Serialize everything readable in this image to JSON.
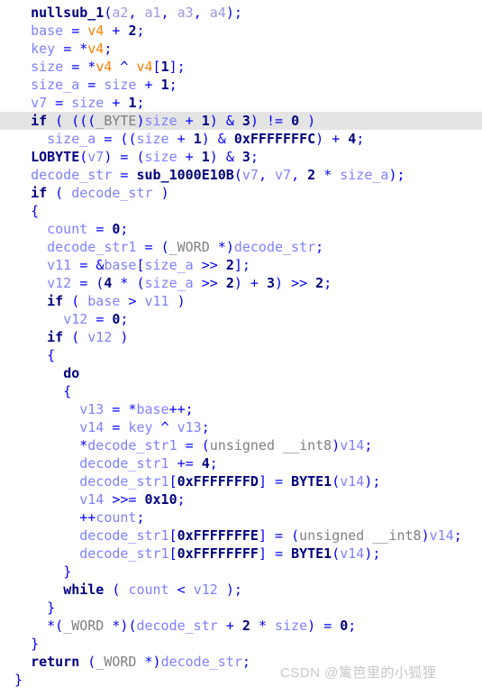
{
  "editor": {
    "kind": "decompiler-pseudocode",
    "language": "C",
    "highlighted_line_index": 6,
    "colors": {
      "background": "#ffffff",
      "highlight_row": "#e4e4e4",
      "keyword": "#00007f",
      "function": "#00007f",
      "local_variable": "#8080ff",
      "argument": "#9a9ae0",
      "register_variable": "#ff8000",
      "number": "#00007f",
      "operator": "#0000ff",
      "type": "#808080",
      "watermark": "#c8c8c8"
    }
  },
  "watermark": {
    "text": "CSDN @篱笆里的小狐狸"
  },
  "code": {
    "lines": [
      "  nullsub_1(a2, a1, a3, a4);",
      "  base = v4 + 2;",
      "  key = *v4;",
      "  size = *v4 ^ v4[1];",
      "  size_a = size + 1;",
      "  v7 = size + 1;",
      "  if ( (((_BYTE)size + 1) & 3) != 0 )",
      "    size_a = ((size + 1) & 0xFFFFFFFC) + 4;",
      "  LOBYTE(v7) = (size + 1) & 3;",
      "  decode_str = sub_1000E10B(v7, v7, 2 * size_a);",
      "  if ( decode_str )",
      "  {",
      "    count = 0;",
      "    decode_str1 = (_WORD *)decode_str;",
      "    v11 = &base[size_a >> 2];",
      "    v12 = (4 * (size_a >> 2) + 3) >> 2;",
      "    if ( base > v11 )",
      "      v12 = 0;",
      "    if ( v12 )",
      "    {",
      "      do",
      "      {",
      "        v13 = *base++;",
      "        v14 = key ^ v13;",
      "        *decode_str1 = (unsigned __int8)v14;",
      "        decode_str1 += 4;",
      "        decode_str1[0xFFFFFFFD] = BYTE1(v14);",
      "        v14 >>= 0x10;",
      "        ++count;",
      "        decode_str1[0xFFFFFFFE] = (unsigned __int8)v14;",
      "        decode_str1[0xFFFFFFFF] = BYTE1(v14);",
      "      }",
      "      while ( count < v12 );",
      "    }",
      "    *(_WORD *)(decode_str + 2 * size) = 0;",
      "  }",
      "  return (_WORD *)decode_str;",
      "}"
    ]
  }
}
